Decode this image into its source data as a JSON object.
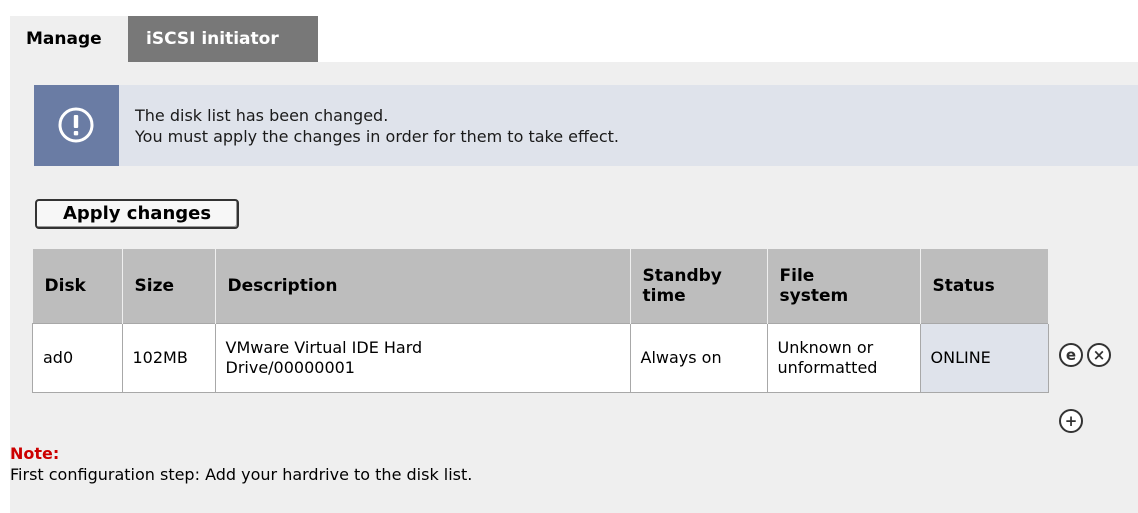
{
  "tabs": [
    {
      "label": "Manage",
      "active": true
    },
    {
      "label": "iSCSI initiator",
      "active": false
    }
  ],
  "alert": {
    "icon": "exclamation-icon",
    "line1": "The disk list has been changed.",
    "line2": "You must apply the changes in order for them to take effect."
  },
  "apply_button": {
    "label": "Apply changes"
  },
  "table": {
    "headers": {
      "disk": "Disk",
      "size": "Size",
      "description": "Description",
      "standby_line1": "Standby",
      "standby_line2": "time",
      "fs_line1": "File",
      "fs_line2": "system",
      "status": "Status"
    },
    "rows": [
      {
        "disk": "ad0",
        "size": "102MB",
        "description_line1": "VMware Virtual IDE Hard",
        "description_line2": "Drive/00000001",
        "standby": "Always on",
        "fs_line1": "Unknown or",
        "fs_line2": "unformatted",
        "status": "ONLINE"
      }
    ]
  },
  "row_actions": {
    "edit_glyph": "e",
    "delete_glyph": "×",
    "add_glyph": "+"
  },
  "note": {
    "label": "Note:",
    "text": "First configuration step: Add your hardrive to the disk list."
  },
  "colors": {
    "panel_bg": "#efefef",
    "inactive_tab_bg": "#787878",
    "alert_bg": "#dfe3eb",
    "alert_icon_bg": "#6a7ca4",
    "table_header_bg": "#bdbdbd",
    "note_label": "#cc0000"
  }
}
